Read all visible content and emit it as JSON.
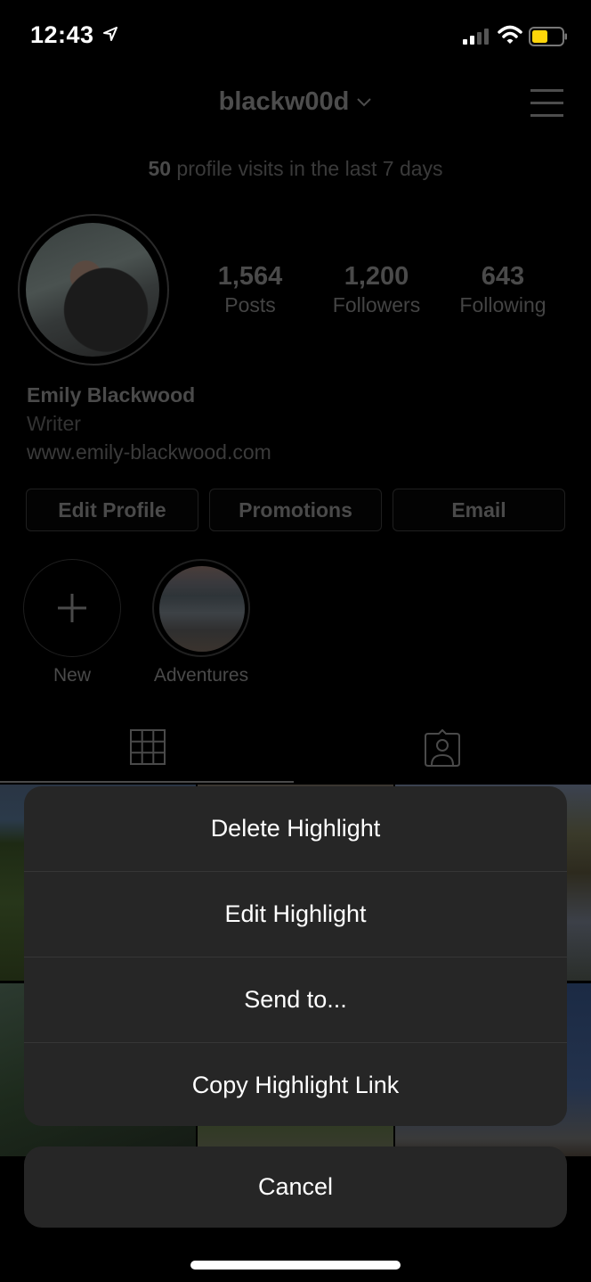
{
  "status_bar": {
    "time": "12:43",
    "location_icon": "location-arrow-icon",
    "signal_bars_filled": 2,
    "signal_bars_total": 4,
    "wifi_icon": "wifi-icon",
    "battery_level_percent": 50,
    "battery_color": "#FFD60A"
  },
  "header": {
    "username": "blackw00d",
    "dropdown_icon": "chevron-down-icon",
    "menu_icon": "hamburger-menu-icon"
  },
  "insights": {
    "count": "50",
    "text": "profile visits in the last 7 days"
  },
  "profile": {
    "stats": [
      {
        "value": "1,564",
        "label": "Posts"
      },
      {
        "value": "1,200",
        "label": "Followers"
      },
      {
        "value": "643",
        "label": "Following"
      }
    ],
    "name": "Emily Blackwood",
    "bio": "Writer",
    "website": "www.emily-blackwood.com",
    "buttons": [
      "Edit Profile",
      "Promotions",
      "Email"
    ]
  },
  "highlights": [
    {
      "label": "New",
      "icon": "plus-icon"
    },
    {
      "label": "Adventures"
    }
  ],
  "tabs": [
    {
      "name": "grid",
      "icon": "grid-icon",
      "active": true
    },
    {
      "name": "tagged",
      "icon": "tagged-person-icon",
      "active": false
    }
  ],
  "action_sheet": {
    "items": [
      "Delete Highlight",
      "Edit Highlight",
      "Send to...",
      "Copy Highlight Link"
    ],
    "cancel": "Cancel",
    "background": "#262626"
  }
}
